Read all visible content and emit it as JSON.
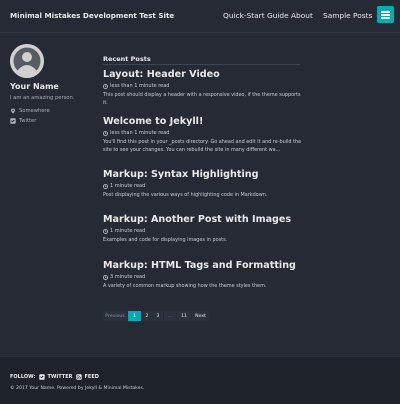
{
  "header": {
    "site_title": "Minimal Mistakes Development Test Site",
    "nav": [
      "Quick-Start Guide",
      "About",
      "Sample Posts"
    ],
    "toggle_icon": "hamburger-menu-icon"
  },
  "sidebar": {
    "name": "Your Name",
    "bio": "I am an amazing person.",
    "links": [
      {
        "icon": "map-marker-icon",
        "label": "Somewhere"
      },
      {
        "icon": "twitter-icon",
        "label": "Twitter"
      }
    ]
  },
  "main": {
    "section_title": "Recent Posts",
    "posts": [
      {
        "title": "Layout: Header Video",
        "read_time": "less than 1 minute read",
        "excerpt": "This post should display a header with a responsive video, if the theme supports it."
      },
      {
        "title": "Welcome to Jekyll!",
        "read_time": "less than 1 minute read",
        "excerpt": "You'll find this post in your _posts directory. Go ahead and edit it and re-build the site to see your changes. You can rebuild the site in many different wa..."
      },
      {
        "title": "Markup: Syntax Highlighting",
        "read_time": "1 minute read",
        "excerpt": "Post displaying the various ways of highlighting code in Markdown."
      },
      {
        "title": "Markup: Another Post with Images",
        "read_time": "1 minute read",
        "excerpt": "Examples and code for displaying images in posts."
      },
      {
        "title": "Markup: HTML Tags and Formatting",
        "read_time": "3 minute read",
        "excerpt": "A variety of common markup showing how the theme styles them."
      }
    ]
  },
  "pagination": {
    "previous": "Previous",
    "pages": [
      "1",
      "2",
      "3",
      "...",
      "11"
    ],
    "current": "1",
    "next": "Next"
  },
  "footer": {
    "follow_label": "FOLLOW:",
    "follow_links": [
      {
        "icon": "twitter-square-icon",
        "label": "TWITTER"
      },
      {
        "icon": "rss-square-icon",
        "label": "FEED"
      }
    ],
    "copyright": "© 2017 Your Name. Powered by Jekyll & Minimal Mistakes."
  },
  "colors": {
    "background": "#252a34",
    "footer_background": "#1e222a",
    "accent": "#00adb5",
    "text": "#eaeaea"
  }
}
